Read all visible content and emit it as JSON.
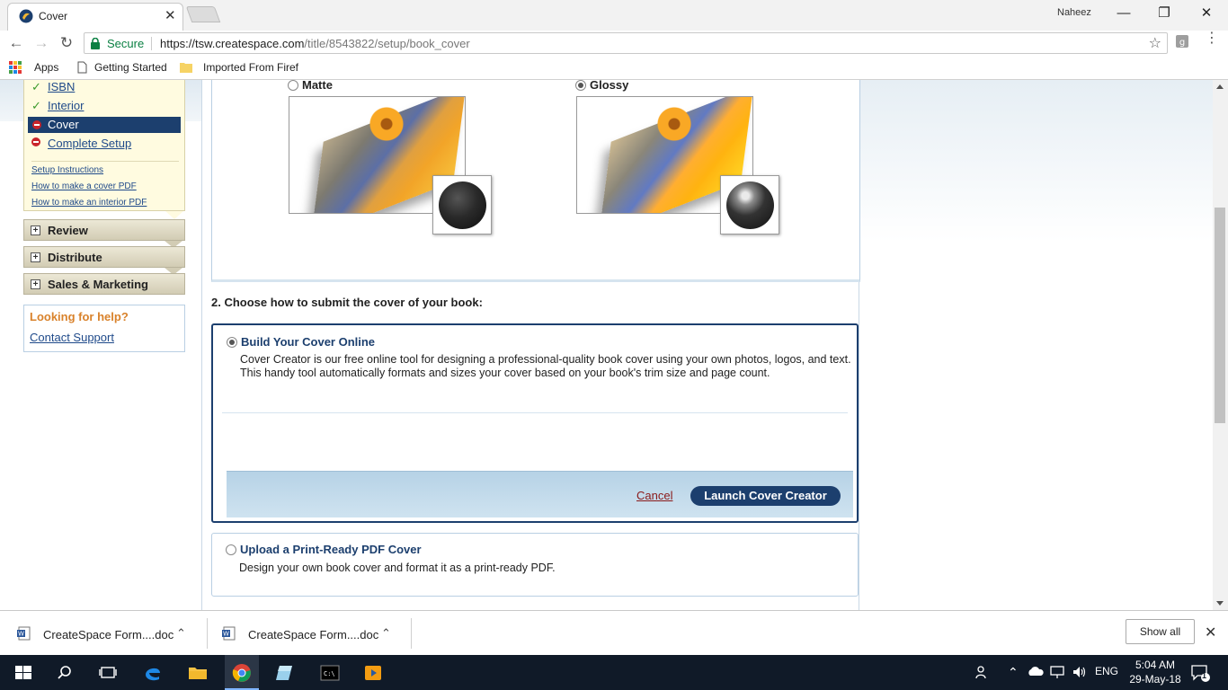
{
  "browser": {
    "tab_title": "Cover",
    "tab_close": "✕",
    "profile_name": "Naheez",
    "window_minimize": "—",
    "window_maximize": "❐",
    "window_close": "✕",
    "secure_label": "Secure",
    "url_base": "https://tsw.createspace.com",
    "url_path": "/title/8543822/setup/book_cover",
    "bookmarks": {
      "apps": "Apps",
      "getting_started": "Getting Started",
      "imported": "Imported From Firef"
    },
    "icons": [
      "back-icon",
      "forward-icon",
      "reload-icon",
      "lock-icon",
      "star-icon",
      "menu-icon"
    ]
  },
  "sidebar": {
    "setup_items": [
      {
        "label": "ISBN",
        "status": "complete"
      },
      {
        "label": "Interior",
        "status": "complete"
      },
      {
        "label": "Cover",
        "status": "active"
      },
      {
        "label": "Complete Setup",
        "status": "incomplete"
      }
    ],
    "help_links": [
      "Setup Instructions",
      "How to make a cover PDF",
      "How to make an interior PDF"
    ],
    "sections": [
      {
        "label": "Review"
      },
      {
        "label": "Distribute"
      },
      {
        "label": "Sales & Marketing"
      }
    ],
    "help_box": {
      "title": "Looking for help?",
      "link": "Contact Support"
    }
  },
  "finish": {
    "matte_label": "Matte",
    "glossy_label": "Glossy",
    "selected": "glossy"
  },
  "submit": {
    "heading": "2. Choose how to submit the cover of your book:",
    "option_online": {
      "title": "Build Your Cover Online",
      "description": "Cover Creator is our free online tool for designing a professional-quality book cover using your own photos, logos, and text. This handy tool automatically formats and sizes your cover based on your book's trim size and page count.",
      "cancel": "Cancel",
      "launch": "Launch Cover Creator",
      "selected": true
    },
    "option_pdf": {
      "title": "Upload a Print-Ready PDF Cover",
      "description": "Design your own book cover and format it as a print-ready PDF.",
      "selected": false
    }
  },
  "downloads": {
    "items": [
      {
        "name": "CreateSpace Form....doc"
      },
      {
        "name": "CreateSpace Form....doc"
      }
    ],
    "show_all": "Show all"
  },
  "taskbar": {
    "lang": "ENG",
    "time": "5:04 AM",
    "date": "29-May-18",
    "notifications": "1"
  },
  "colors": {
    "nav_active": "#1c3f6e",
    "link": "#1f4a8a",
    "help_title": "#d9822b",
    "secure_green": "#0b8043"
  }
}
